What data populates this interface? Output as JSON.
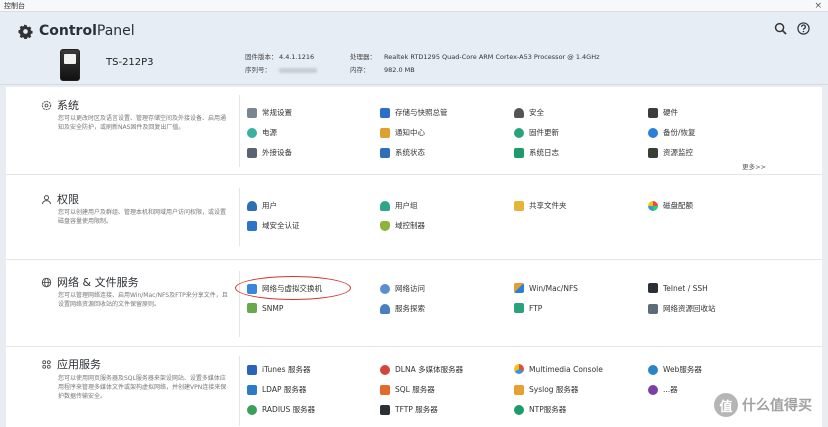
{
  "window": {
    "title": "控制台",
    "close": "×"
  },
  "header": {
    "brand_bold": "Control",
    "brand_rest": "Panel",
    "model": "TS-212P3",
    "firmware_label": "固件版本：",
    "firmware_value": "4.4.1.1216",
    "serial_label": "序列号：",
    "cpu_label": "处理器：",
    "cpu_value": "Realtek RTD1295 Quad-Core ARM Cortex-A53 Processor @ 1.4GHz",
    "memory_label": "内存：",
    "memory_value": "982.0 MB"
  },
  "sections": {
    "system": {
      "title": "系统",
      "desc": "您可以更改时区及语言设置、管理存储空间及外接设备、启用通知及安全防护，或刷新NAS固件及回复出厂值。",
      "items": [
        "常规设置",
        "存储与快照总管",
        "安全",
        "硬件",
        "电源",
        "通知中心",
        "固件更新",
        "备份/恢复",
        "外接设备",
        "系统状态",
        "系统日志",
        "资源监控"
      ],
      "more": "更多>>"
    },
    "privilege": {
      "title": "权限",
      "desc": "您可以创建用户及群组、管理本机和网域用户访问权限，或设置磁盘容量使用限制。",
      "items": [
        "用户",
        "用户组",
        "共享文件夹",
        "磁盘配额",
        "域安全认证",
        "域控制器"
      ]
    },
    "network": {
      "title": "网络 & 文件服务",
      "desc": "您可以管理网络连接、启用Win/Mac/NFS及FTP来分享文件，且设置网络资源回收站的文件保留原则。",
      "items": [
        "网络与虚拟交换机",
        "网络访问",
        "Win/Mac/NFS",
        "Telnet / SSH",
        "SNMP",
        "服务探索",
        "FTP",
        "网络资源回收站"
      ]
    },
    "apps": {
      "title": "应用服务",
      "desc": "您可以使用网页服务器及SQL服务器来架设网站、设置多媒体应用程序来管理多媒体文件或架构虚拟网络，并创建VPN连接来保护数据传输安全。",
      "items": [
        "iTunes 服务器",
        "DLNA 多媒体服务器",
        "Multimedia Console",
        "Web服务器",
        "LDAP 服务器",
        "SQL 服务器",
        "Syslog 服务器",
        "...器",
        "RADIUS 服务器",
        "TFTP 服务器",
        "NTP服务器"
      ]
    }
  },
  "watermark": {
    "badge": "值",
    "text": "什么值得买"
  },
  "colors": {
    "highlight": "#d8322b",
    "header_bg": "#e7edf5"
  }
}
